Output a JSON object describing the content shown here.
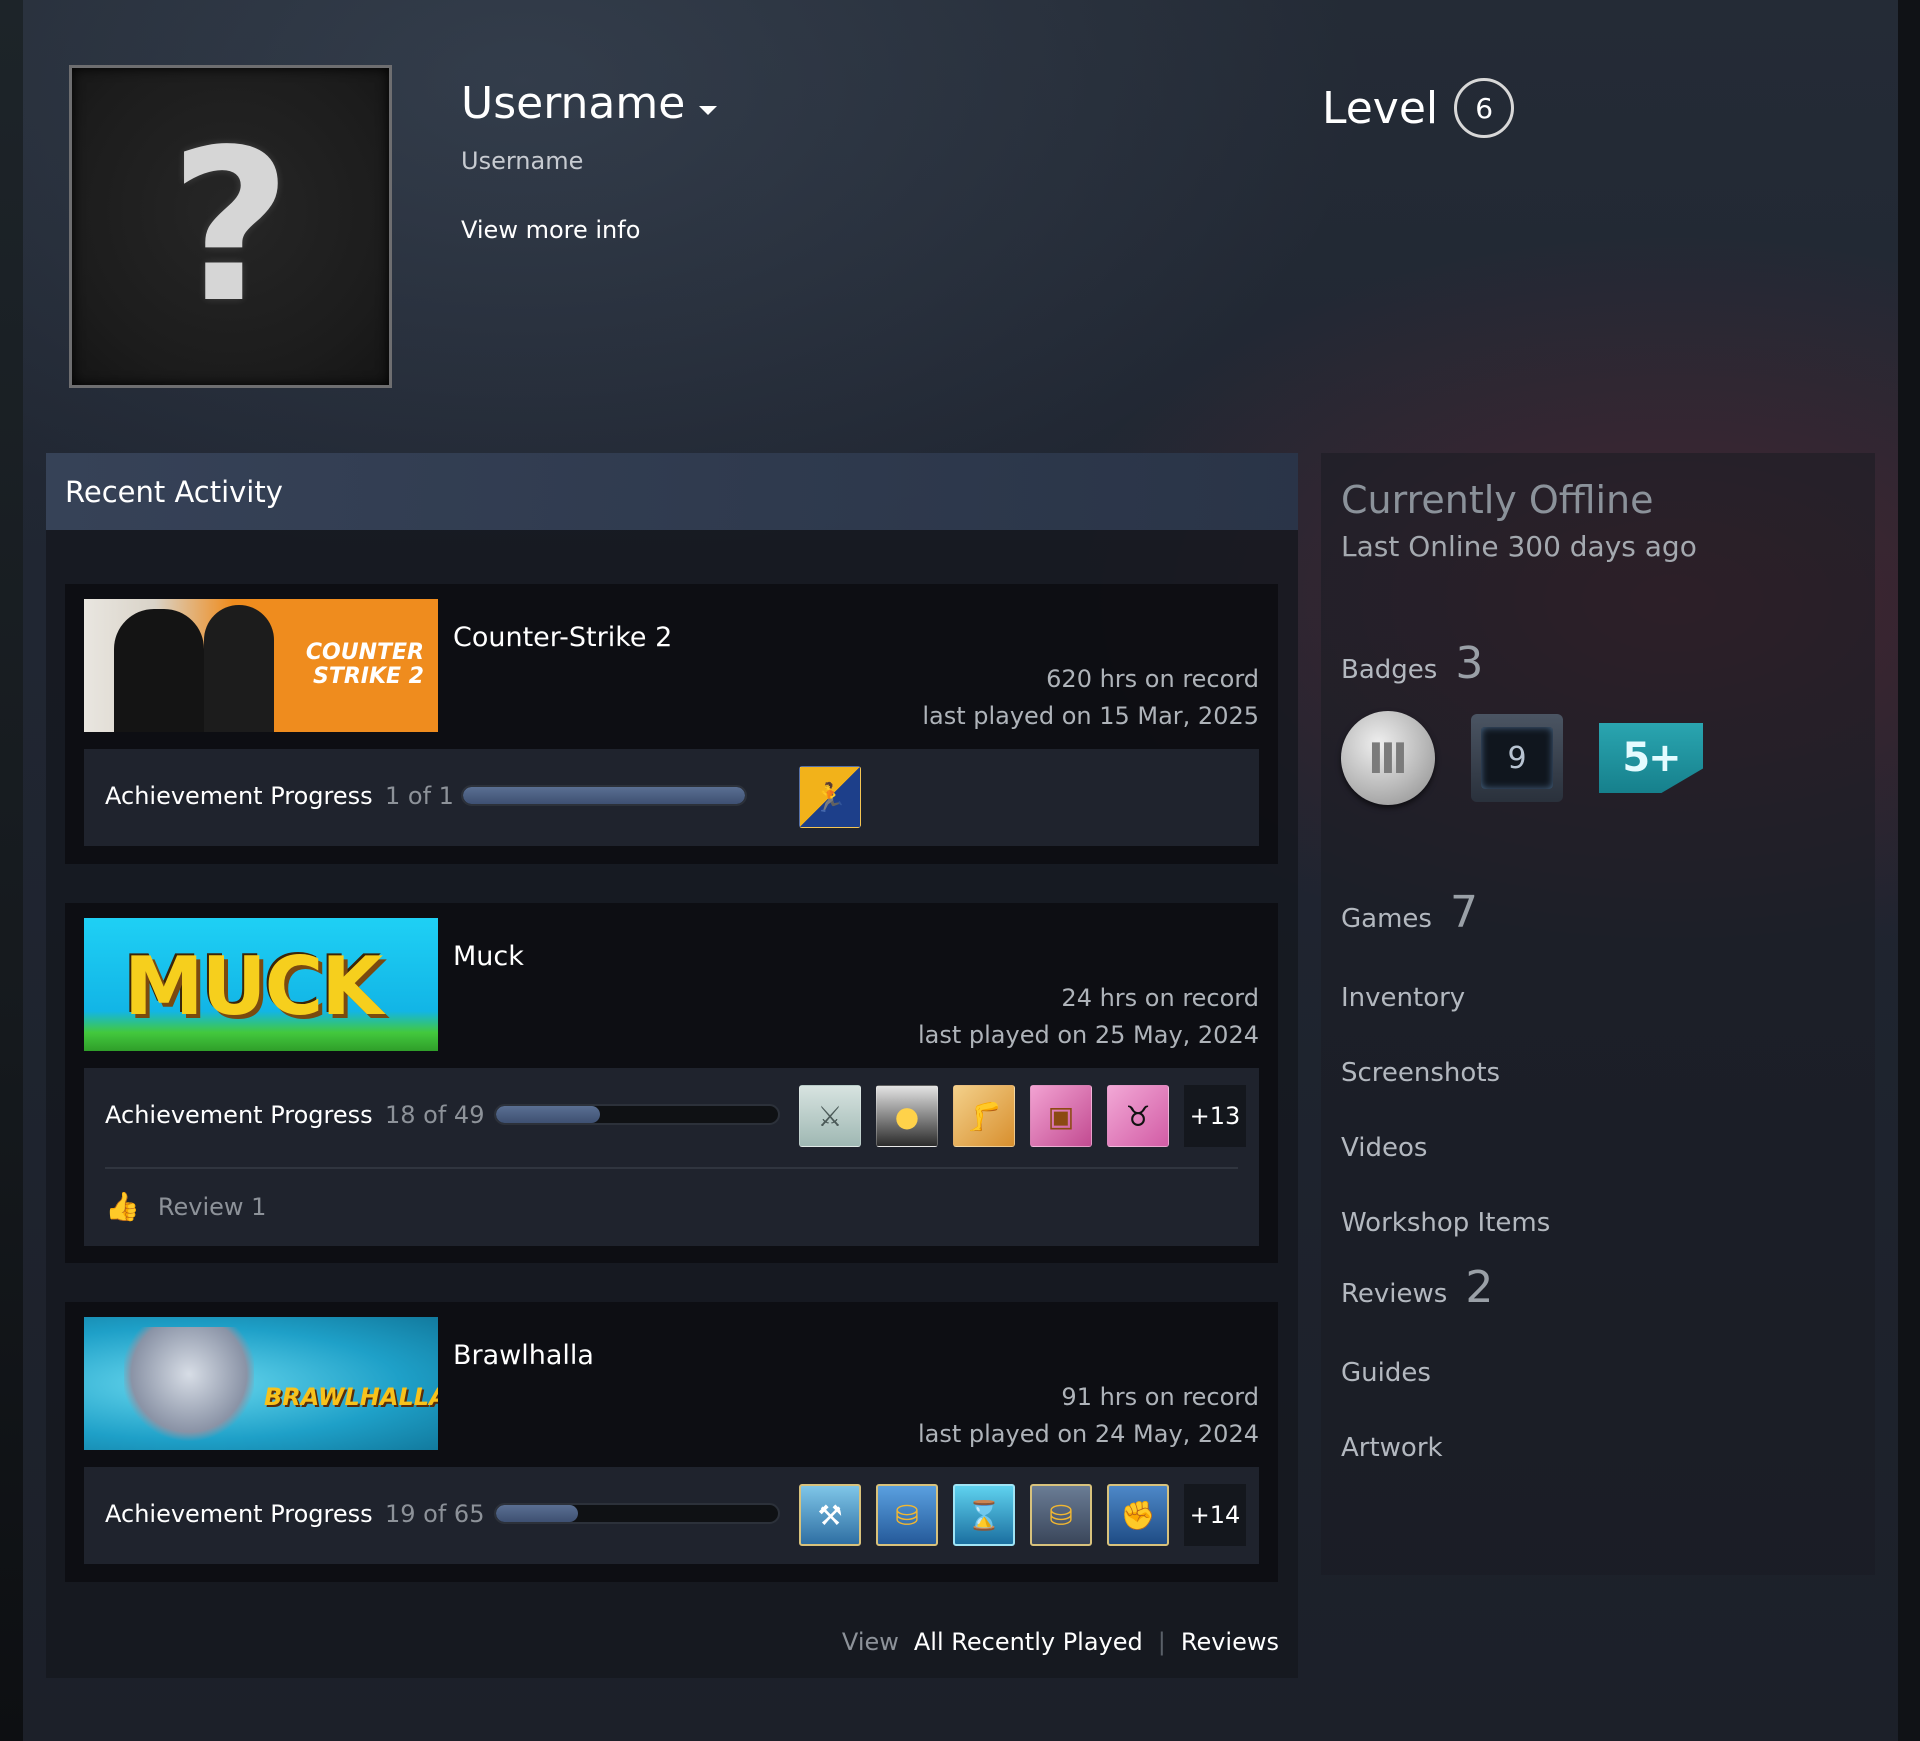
{
  "profile": {
    "avatar_glyph": "?",
    "persona_name": "Username",
    "real_name": "Username",
    "view_more_info": "View more info",
    "level_label": "Level",
    "level_value": "6"
  },
  "activity": {
    "title": "Recent Activity",
    "achievement_label": "Achievement Progress",
    "games": [
      {
        "name": "Counter-Strike 2",
        "capsule_text": "COUNTER STRIKE 2",
        "hours": "620 hrs on record",
        "last_played": "last played on 15 Mar, 2025",
        "achievements": "1 of 1",
        "progress": 1.0,
        "more": ""
      },
      {
        "name": "Muck",
        "capsule_text": "MUCK",
        "hours": "24 hrs on record",
        "last_played": "last played on 25 May, 2024",
        "achievements": "18 of 49",
        "progress": 0.367,
        "more": "+13",
        "review": "Review 1"
      },
      {
        "name": "Brawlhalla",
        "capsule_text": "BRAWLHALLA",
        "hours": "91 hrs on record",
        "last_played": "last played on 24 May, 2024",
        "achievements": "19 of 65",
        "progress": 0.292,
        "more": "+14"
      }
    ],
    "view_label": "View",
    "all_recently_played": "All Recently Played",
    "reviews_link": "Reviews",
    "separator": "|"
  },
  "sidebar": {
    "status": "Currently Offline",
    "last_online": "Last Online 300 days ago",
    "badges_label": "Badges",
    "badges_count": "3",
    "badge_years_value": "9",
    "badge_5plus_text": "5+",
    "games_label": "Games",
    "games_count": "7",
    "inventory": "Inventory",
    "screenshots": "Screenshots",
    "videos": "Videos",
    "workshop": "Workshop Items",
    "reviews_label": "Reviews",
    "reviews_count": "2",
    "guides": "Guides",
    "artwork": "Artwork"
  },
  "colors": {
    "accent_progress": "#4a5e82",
    "panel_header": "#38445a",
    "cs2_orange": "#ef8c1e",
    "muck_sky": "#17c8ee",
    "brawl_blue": "#1ea0c8"
  }
}
